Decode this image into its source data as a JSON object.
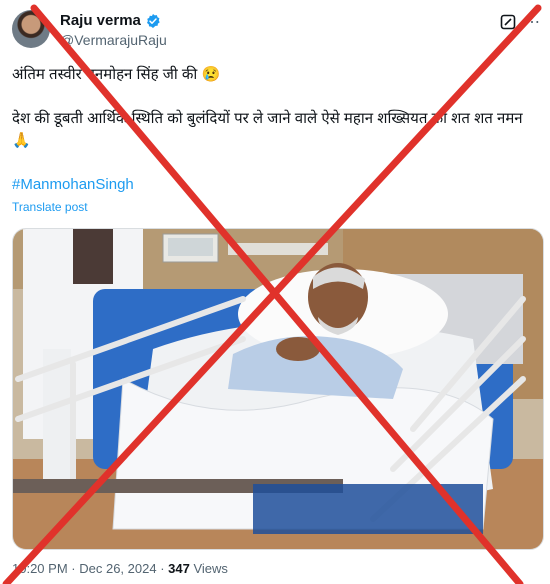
{
  "author": {
    "display_name": "Raju verma",
    "handle": "@VermarajuRaju"
  },
  "post": {
    "line1": "अंतिम तस्वीर मनमोहन सिंह जी की 😢",
    "line2": "देश की डूबती आर्थिक स्थिति को बुलंदियों पर ले जाने वाले ऐसे महान शख्सियत को शत शत नमन 🙏",
    "hashtag": "#ManmohanSingh",
    "translate": "Translate post"
  },
  "meta": {
    "time": "10:20 PM",
    "date": "Dec 26, 2024",
    "views_count": "347",
    "views_label": "Views"
  },
  "colors": {
    "link": "#1d9bf0",
    "cross": "#e0322b",
    "muted": "#536471"
  },
  "icons": [
    "verified-badge-icon",
    "grok-icon",
    "more-icon"
  ]
}
